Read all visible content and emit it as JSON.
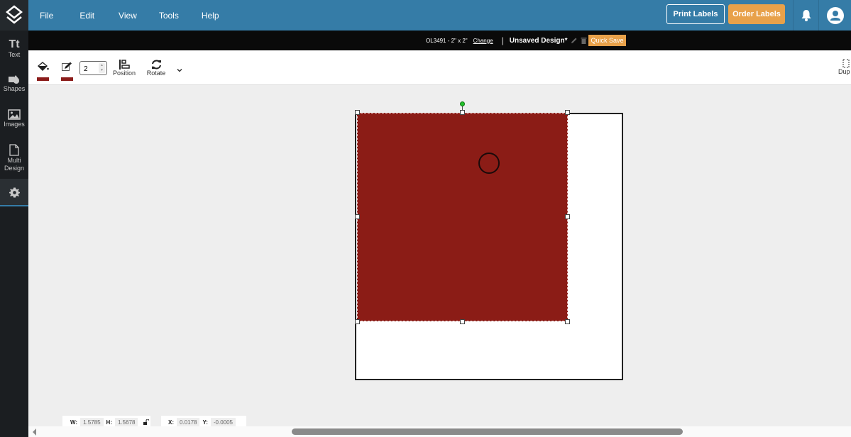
{
  "app": {
    "logo": "layers-logo",
    "menu": [
      "File",
      "Edit",
      "View",
      "Tools",
      "Help"
    ],
    "buttons": {
      "print": "Print Labels",
      "order": "Order Labels"
    },
    "icons": {
      "notifications": "bell-icon",
      "account": "user-circle-icon"
    },
    "colors": {
      "brand": "#357ca7",
      "accent": "#e8a14a",
      "fill": "#8b1c16"
    }
  },
  "sidebar": {
    "items": [
      {
        "label": "Text",
        "icon": "text-icon"
      },
      {
        "label": "Shapes",
        "icon": "shapes-icon"
      },
      {
        "label": "Images",
        "icon": "image-icon"
      },
      {
        "label": "Multi Design",
        "icon": "file-icon"
      },
      {
        "label": "",
        "icon": "gear-icon",
        "active": true
      }
    ]
  },
  "infobar": {
    "sku": "OL3491 - 2\" x 2\"",
    "change": "Change",
    "separator": "|",
    "design_name": "Unsaved Design*",
    "quick_save": "Quick Save"
  },
  "toolbar": {
    "fill_color": "#8b1c1a",
    "stroke_color": "#8b1c1a",
    "stroke_width": "2",
    "position": "Position",
    "rotate": "Rotate",
    "duplicate": "Dup"
  },
  "footer": {
    "w_label": "W:",
    "w_value": "1.5785",
    "h_label": "H:",
    "h_value": "1.5678",
    "x_label": "X:",
    "x_value": "0.0178",
    "y_label": "Y:",
    "y_value": "-0.0005"
  }
}
